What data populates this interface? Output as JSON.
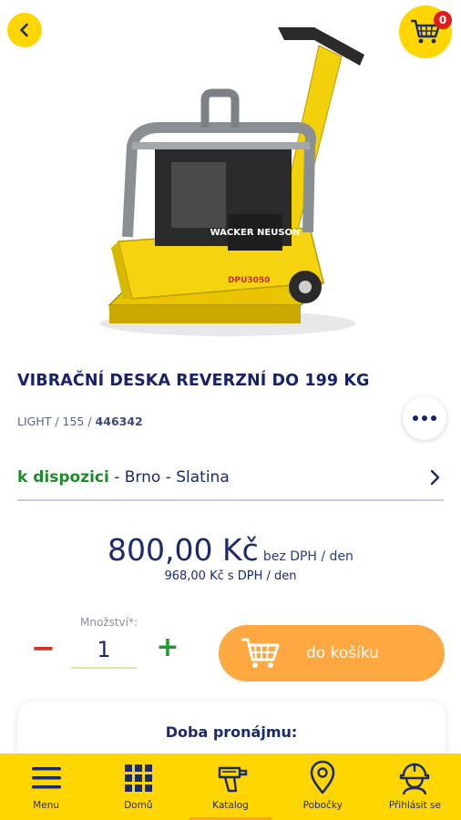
{
  "header": {
    "cart_count": "0"
  },
  "product": {
    "title": "VIBRAČNÍ DESKA REVERZNÍ DO 199 KG",
    "meta_prefix": "LIGHT / 155 / ",
    "meta_code": "446342",
    "brand_text": "WACKER NEUSON",
    "model_text": "DPU3050"
  },
  "availability": {
    "status": "k dispozici",
    "location": " - Brno - Slatina"
  },
  "price": {
    "main": "800,00 Kč",
    "main_suffix": "bez DPH / den",
    "with_vat": "968,00 Kč s DPH / den"
  },
  "quantity": {
    "label": "Množství*:",
    "value": "1",
    "minus": "−",
    "plus": "+"
  },
  "actions": {
    "add_to_cart": "do košíku"
  },
  "rental": {
    "title": "Doba pronájmu:"
  },
  "nav": [
    {
      "label": "Menu",
      "icon": "menu-icon"
    },
    {
      "label": "Domů",
      "icon": "grid-icon"
    },
    {
      "label": "Katalog",
      "icon": "drill-icon"
    },
    {
      "label": "Pobočky",
      "icon": "location-pin-icon"
    },
    {
      "label": "Přihlásit se",
      "icon": "worker-helmet-icon"
    }
  ],
  "colors": {
    "accent_yellow": "#ffd600",
    "navy": "#1b2a6b",
    "orange_button": "#ffa741",
    "green_status": "#1f8a2a",
    "red_badge": "#e01b1b"
  }
}
